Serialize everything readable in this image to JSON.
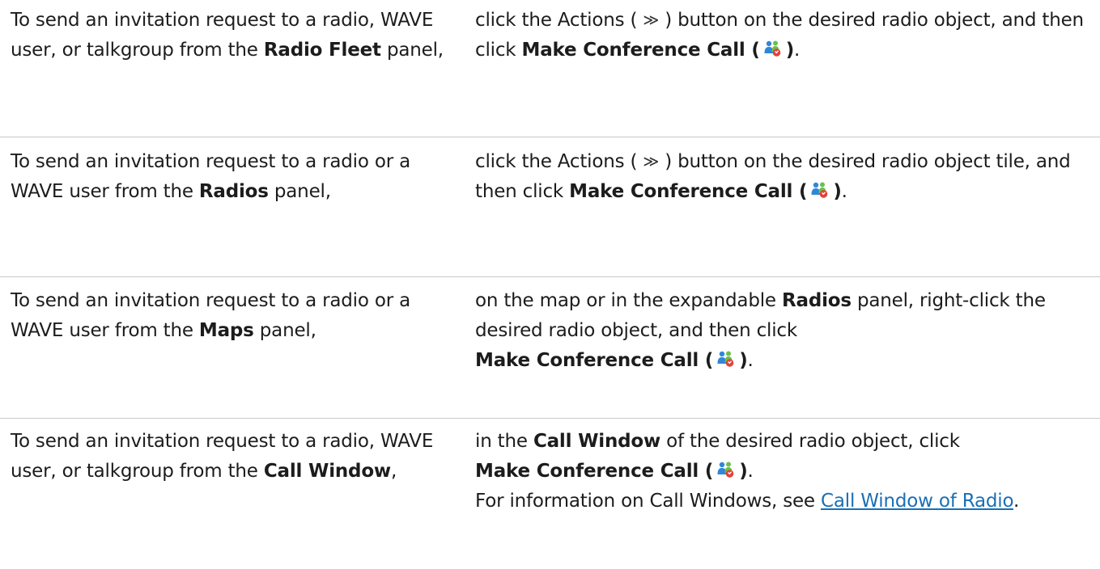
{
  "icons": {
    "actions": "actions-double-chevron-icon",
    "conference": "conference-call-icon"
  },
  "colors": {
    "link": "#1a6fb5",
    "divider": "#c8c8c8",
    "icon_person_blue": "#2f87d9",
    "icon_person_green": "#6cc04a",
    "icon_badge_red": "#e0433a"
  },
  "glyphs": {
    "actions": "≫",
    "paren_open": "(",
    "paren_close": ")"
  },
  "rows": [
    {
      "left": {
        "before": "To send an invitation request to a radio, WAVE user, or talkgroup from the ",
        "bold": "Radio Fleet",
        "after": " panel,"
      },
      "right": {
        "t1": "click the Actions ( ",
        "t2": " ) button on the desired radio object, and then click ",
        "bold": "Make Conference Call (",
        "end": "."
      }
    },
    {
      "left": {
        "before": "To send an invitation request to a radio or a WAVE user from the ",
        "bold": "Radios",
        "after": " panel,"
      },
      "right": {
        "t1": "click the Actions ( ",
        "t2": " ) button on the desired radio object tile, and then click ",
        "bold": "Make Conference Call (",
        "end": "."
      }
    },
    {
      "left": {
        "before": "To send an invitation request to a radio or a WAVE user from the ",
        "bold": "Maps",
        "after": " panel,"
      },
      "right": {
        "t1": "on the map or in the expandable ",
        "bold1": "Radios",
        "t2": " panel, right-click the desired radio object, and then click",
        "bold": "Make Conference Call (",
        "end": "."
      }
    },
    {
      "left": {
        "before": "To send an invitation request to a radio, WAVE user, or talkgroup from the ",
        "bold": "Call Window",
        "after": ","
      },
      "right": {
        "t1": "in the ",
        "bold1": "Call Window",
        "t2": " of the desired radio object, click",
        "bold": "Make Conference Call (",
        "end": ".",
        "info_before": "For information on Call Windows, see ",
        "link": "Call Window of Radio",
        "info_after": "."
      }
    }
  ]
}
